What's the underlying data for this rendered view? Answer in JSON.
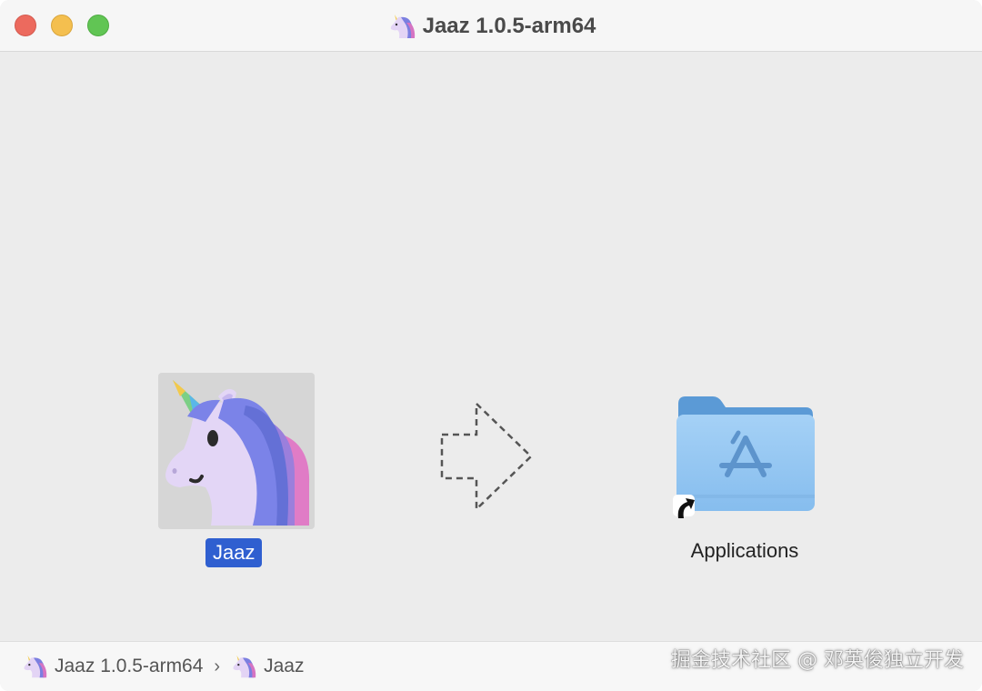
{
  "window": {
    "title": "Jaaz 1.0.5-arm64",
    "title_icon": "unicorn-icon"
  },
  "content": {
    "app": {
      "label": "Jaaz",
      "icon": "unicorn-app-icon"
    },
    "arrow_icon": "dashed-right-arrow-icon",
    "destination": {
      "label": "Applications",
      "icon": "applications-folder-icon",
      "alias_icon": "alias-arrow-icon"
    }
  },
  "pathbar": {
    "items": [
      {
        "label": "Jaaz 1.0.5-arm64",
        "icon": "unicorn-icon"
      },
      {
        "label": "Jaaz",
        "icon": "unicorn-icon"
      }
    ],
    "separator": "›"
  },
  "watermark": "掘金技术社区 @ 邓英俊独立开发",
  "colors": {
    "selection": "#2f5fd0",
    "folder": "#8ec2ef",
    "close": "#ec6a5e",
    "minimize": "#f4bf4f",
    "zoom": "#61c554"
  }
}
